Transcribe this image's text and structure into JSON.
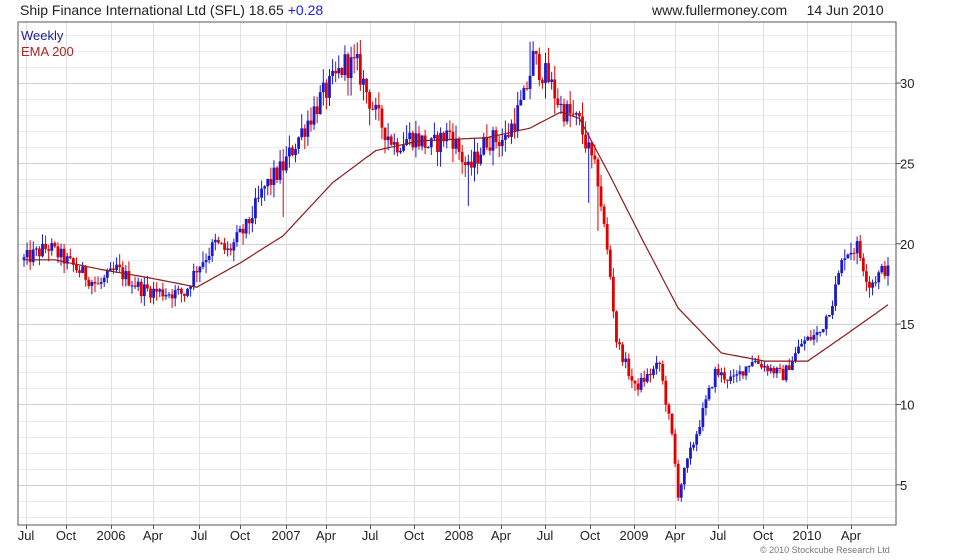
{
  "header": {
    "title": "Ship Finance International Ltd (SFL) 18.65",
    "change": "+0.28",
    "site": "www.fullermoney.com",
    "date": "14 Jun 2010"
  },
  "legend": {
    "weekly": "Weekly",
    "ema": "EMA 200"
  },
  "footer": {
    "copyright": "© 2010 Stockcube Research Ltd"
  },
  "colors": {
    "up": "#1a1acc",
    "down": "#e00000",
    "ema": "#8b1a1a",
    "grid": "#d8d8d8"
  },
  "chart_data": {
    "type": "candlestick",
    "x_ticks": [
      "Jul",
      "Oct",
      "2006",
      "Apr",
      "Jul",
      "Oct",
      "2007",
      "Apr",
      "Jul",
      "Oct",
      "2008",
      "Apr",
      "Jul",
      "Oct",
      "2009",
      "Apr",
      "Jul",
      "Oct",
      "2010",
      "Apr"
    ],
    "y_ticks": [
      5,
      10,
      15,
      20,
      25,
      30
    ],
    "ylim": [
      2.5,
      33.8
    ],
    "y_axis_side": "right",
    "grid": true,
    "series": [
      {
        "name": "Weekly",
        "approx_path": [
          [
            0,
            19.0
          ],
          [
            8,
            19.8
          ],
          [
            16,
            18.6
          ],
          [
            24,
            17.4
          ],
          [
            30,
            18.4
          ],
          [
            38,
            17.2
          ],
          [
            44,
            17.0
          ],
          [
            52,
            16.9
          ],
          [
            56,
            18.5
          ],
          [
            62,
            20.0
          ],
          [
            66,
            19.5
          ],
          [
            72,
            21.0
          ],
          [
            78,
            23.5
          ],
          [
            84,
            24.8
          ],
          [
            90,
            27.0
          ],
          [
            96,
            29.0
          ],
          [
            100,
            30.0
          ],
          [
            104,
            31.2
          ],
          [
            108,
            31.0
          ],
          [
            114,
            28.0
          ],
          [
            120,
            26.2
          ],
          [
            126,
            26.7
          ],
          [
            132,
            26.0
          ],
          [
            138,
            27.0
          ],
          [
            144,
            24.5
          ],
          [
            150,
            26.5
          ],
          [
            156,
            26.5
          ],
          [
            162,
            29.0
          ],
          [
            165,
            31.5
          ],
          [
            170,
            30.2
          ],
          [
            174,
            28.5
          ],
          [
            180,
            27.5
          ],
          [
            186,
            24.0
          ],
          [
            190,
            18.0
          ],
          [
            192,
            14.0
          ],
          [
            198,
            11.0
          ],
          [
            206,
            12.5
          ],
          [
            210,
            8.0
          ],
          [
            212,
            4.5
          ],
          [
            216,
            7.0
          ],
          [
            224,
            12.0
          ],
          [
            230,
            11.5
          ],
          [
            236,
            12.8
          ],
          [
            240,
            12.4
          ],
          [
            246,
            11.8
          ],
          [
            252,
            13.8
          ],
          [
            258,
            14.5
          ],
          [
            262,
            16.5
          ],
          [
            266,
            19.5
          ],
          [
            270,
            19.8
          ],
          [
            274,
            17.5
          ],
          [
            280,
            18.65
          ]
        ]
      },
      {
        "name": "EMA 200",
        "approx_path": [
          [
            0,
            19.0
          ],
          [
            10,
            19.0
          ],
          [
            25,
            18.4
          ],
          [
            40,
            17.9
          ],
          [
            56,
            17.3
          ],
          [
            70,
            18.8
          ],
          [
            84,
            20.5
          ],
          [
            100,
            23.8
          ],
          [
            114,
            25.8
          ],
          [
            128,
            26.4
          ],
          [
            150,
            26.6
          ],
          [
            164,
            27.2
          ],
          [
            174,
            28.2
          ],
          [
            180,
            27.8
          ],
          [
            190,
            24.2
          ],
          [
            200,
            20.4
          ],
          [
            212,
            16.0
          ],
          [
            226,
            13.2
          ],
          [
            240,
            12.7
          ],
          [
            254,
            12.7
          ],
          [
            266,
            14.3
          ],
          [
            280,
            16.2
          ]
        ]
      }
    ]
  }
}
